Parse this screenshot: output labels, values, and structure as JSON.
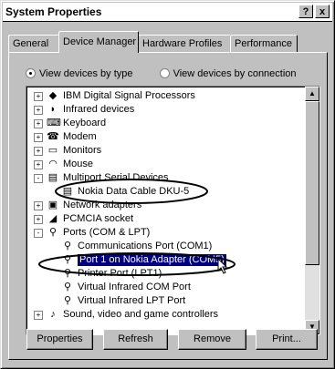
{
  "window": {
    "title": "System Properties",
    "help_label": "?",
    "close_label": "x"
  },
  "tabs": [
    {
      "label": "General",
      "active": false
    },
    {
      "label": "Device Manager",
      "active": true
    },
    {
      "label": "Hardware Profiles",
      "active": false
    },
    {
      "label": "Performance",
      "active": false
    }
  ],
  "view": {
    "by_type": "View devices by type",
    "by_connection": "View devices by connection",
    "selected": "by_type"
  },
  "tree": [
    {
      "text": "IBM Digital Signal Processors",
      "icon": "dsp-icon",
      "expander": "+"
    },
    {
      "text": "Infrared devices",
      "icon": "infrared-icon",
      "expander": "+"
    },
    {
      "text": "Keyboard",
      "icon": "keyboard-icon",
      "expander": "+"
    },
    {
      "text": "Modem",
      "icon": "modem-icon",
      "expander": "+"
    },
    {
      "text": "Monitors",
      "icon": "monitor-icon",
      "expander": "+"
    },
    {
      "text": "Mouse",
      "icon": "mouse-icon",
      "expander": "+"
    },
    {
      "text": "Multiport Serial Devices",
      "icon": "serial-icon",
      "expander": "-"
    },
    {
      "text": "Nokia Data Cable DKU-5",
      "icon": "serial-device-icon",
      "child": true
    },
    {
      "text": "Network adapters",
      "icon": "network-icon",
      "expander": "+"
    },
    {
      "text": "PCMCIA socket",
      "icon": "pcmcia-icon",
      "expander": "+"
    },
    {
      "text": "Ports (COM & LPT)",
      "icon": "port-icon",
      "expander": "-"
    },
    {
      "text": "Communications Port (COM1)",
      "icon": "port-icon",
      "child": true
    },
    {
      "text": "Port 1 on Nokia Adapter (COM5)",
      "icon": "port-icon",
      "child": true,
      "selected": true
    },
    {
      "text": "Printer Port (LPT1)",
      "icon": "port-icon",
      "child": true
    },
    {
      "text": "Virtual Infrared COM Port",
      "icon": "port-icon",
      "child": true
    },
    {
      "text": "Virtual Infrared LPT Port",
      "icon": "port-icon",
      "child": true
    },
    {
      "text": "Sound, video and game controllers",
      "icon": "sound-icon",
      "expander": "+"
    }
  ],
  "buttons": {
    "properties": "Properties",
    "refresh": "Refresh",
    "remove": "Remove",
    "print": "Print..."
  },
  "colors": {
    "selection": "#000080",
    "annotation": "#000000"
  }
}
